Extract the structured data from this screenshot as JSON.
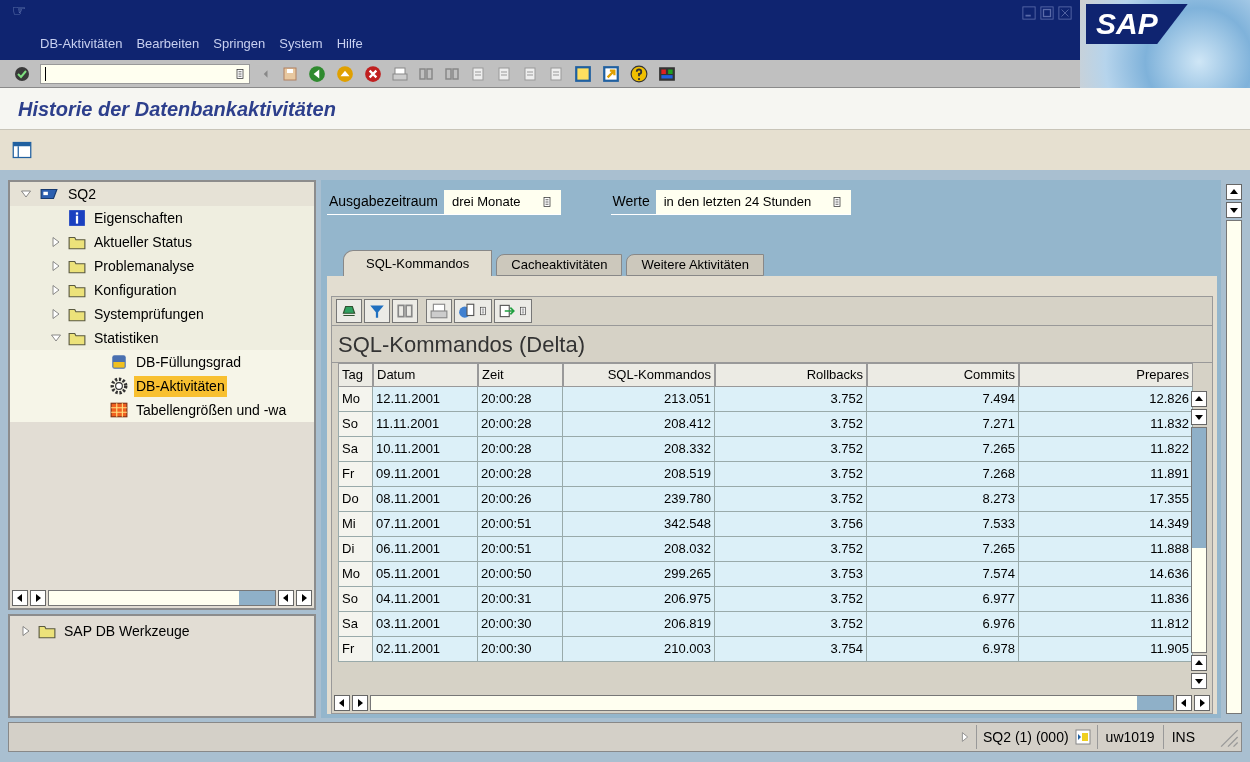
{
  "window": {
    "title_icon": "☞",
    "logo": "SAP"
  },
  "menu": [
    "DB-Aktivitäten",
    "Bearbeiten",
    "Springen",
    "System",
    "Hilfe"
  ],
  "page_title": "Historie der Datenbankaktivitäten",
  "tree": [
    {
      "label": "SQ2",
      "kind": "system",
      "expanded": true,
      "selected": false,
      "children": [
        {
          "label": "Eigenschaften",
          "kind": "info",
          "selected": false
        },
        {
          "label": "Aktueller Status",
          "kind": "folder",
          "expanded": false,
          "selected": false
        },
        {
          "label": "Problemanalyse",
          "kind": "folder",
          "expanded": false,
          "selected": false
        },
        {
          "label": "Konfiguration",
          "kind": "folder",
          "expanded": false,
          "selected": false
        },
        {
          "label": "Systemprüfungen",
          "kind": "folder",
          "expanded": false,
          "selected": false
        },
        {
          "label": "Statistiken",
          "kind": "folder",
          "expanded": true,
          "selected": false,
          "children": [
            {
              "label": "DB-Füllungsgrad",
              "kind": "disk",
              "selected": false
            },
            {
              "label": "DB-Aktivitäten",
              "kind": "gear",
              "selected": true
            },
            {
              "label": "Tabellengrößen und -wa",
              "kind": "table",
              "selected": false
            }
          ]
        }
      ]
    }
  ],
  "tools_tree": [
    {
      "label": "SAP DB Werkzeuge",
      "kind": "folder",
      "expanded": false,
      "selected": false
    }
  ],
  "filters": [
    {
      "label": "Ausgabezeitraum",
      "value": "drei Monate"
    },
    {
      "label": "Werte",
      "value": "in den letzten 24 Stunden"
    }
  ],
  "tabs": [
    {
      "label": "SQL-Kommandos",
      "selected": true
    },
    {
      "label": "Cacheaktivitäten",
      "selected": false
    },
    {
      "label": "Weitere Aktivitäten",
      "selected": false
    }
  ],
  "grid": {
    "title": "SQL-Kommandos (Delta)",
    "columns": [
      "Tag",
      "Datum",
      "Zeit",
      "SQL-Kommandos",
      "Rollbacks",
      "Commits",
      "Prepares"
    ],
    "rows": [
      [
        "Mo",
        "12.11.2001",
        "20:00:28",
        "213.051",
        "3.752",
        "7.494",
        "12.826"
      ],
      [
        "So",
        "11.11.2001",
        "20:00:28",
        "208.412",
        "3.752",
        "7.271",
        "11.832"
      ],
      [
        "Sa",
        "10.11.2001",
        "20:00:28",
        "208.332",
        "3.752",
        "7.265",
        "11.822"
      ],
      [
        "Fr",
        "09.11.2001",
        "20:00:28",
        "208.519",
        "3.752",
        "7.268",
        "11.891"
      ],
      [
        "Do",
        "08.11.2001",
        "20:00:26",
        "239.780",
        "3.752",
        "8.273",
        "17.355"
      ],
      [
        "Mi",
        "07.11.2001",
        "20:00:51",
        "342.548",
        "3.756",
        "7.533",
        "14.349"
      ],
      [
        "Di",
        "06.11.2001",
        "20:00:51",
        "208.032",
        "3.752",
        "7.265",
        "11.888"
      ],
      [
        "Mo",
        "05.11.2001",
        "20:00:50",
        "299.265",
        "3.753",
        "7.574",
        "14.636"
      ],
      [
        "So",
        "04.11.2001",
        "20:00:31",
        "206.975",
        "3.752",
        "6.977",
        "11.836"
      ],
      [
        "Sa",
        "03.11.2001",
        "20:00:30",
        "206.819",
        "3.752",
        "6.976",
        "11.812"
      ],
      [
        "Fr",
        "02.11.2001",
        "20:00:30",
        "210.003",
        "3.754",
        "6.978",
        "11.905"
      ]
    ]
  },
  "status_bar": {
    "system": "SQ2 (1) (000)",
    "server": "uw1019",
    "mode": "INS"
  }
}
